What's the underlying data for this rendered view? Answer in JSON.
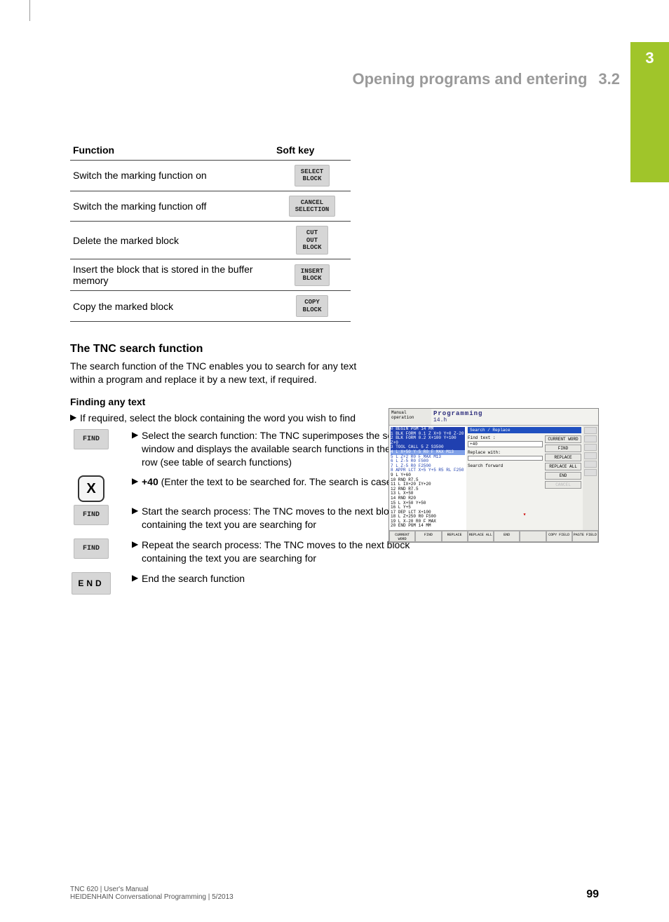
{
  "sideTabChapter": "3",
  "header": {
    "title": "Opening programs and entering",
    "section": "3.2"
  },
  "table": {
    "col1": "Function",
    "col2": "Soft key",
    "rows": [
      {
        "desc": "Switch the marking function on",
        "key": "SELECT\nBLOCK"
      },
      {
        "desc": "Switch the marking function off",
        "key": "CANCEL\nSELECTION"
      },
      {
        "desc": "Delete the marked block",
        "key": "CUT\nOUT\nBLOCK"
      },
      {
        "desc": "Insert the block that is stored in the buffer memory",
        "key": "INSERT\nBLOCK"
      },
      {
        "desc": "Copy the marked block",
        "key": "COPY\nBLOCK"
      }
    ]
  },
  "subheading": "The TNC search function",
  "subpara": "The search function of the TNC enables you to search for any text within a program and replace it by a new text, if required.",
  "minihead": "Finding any text",
  "step0": "If required, select the block containing the word you wish to find",
  "steps": [
    {
      "iconType": "softkey",
      "iconLabel": "FIND",
      "text": "Select the search function: The TNC superimposes the search window and displays the available search functions in the soft-key row (see table of search functions)"
    },
    {
      "iconType": "axis",
      "iconLabel": "X",
      "bold": "+40",
      "text": " (Enter the text to be searched for. The search is case-sensitive.)"
    },
    {
      "iconType": "softkey",
      "iconLabel": "FIND",
      "text": "Start the search process: The TNC moves to the next block containing the text you are searching for"
    },
    {
      "iconType": "softkey",
      "iconLabel": "FIND",
      "text": "Repeat the search process: The TNC moves to the next block containing the text you are searching for"
    },
    {
      "iconType": "end",
      "iconLabel": "END",
      "text": "End the search function"
    }
  ],
  "screenshot": {
    "mode": "Manual operation",
    "title": "Programming",
    "file": "14.h",
    "program": [
      "0  BEGIN PGM 14 MM",
      "1  BLK FORM 0.1 Z X+0 Y+0 Z-20",
      "2  BLK FORM 0.2 X+100 Y+100 Z+0",
      "3  TOOL CALL 5 Z S3500",
      "4  L X+50 Y-5 R0 F MAX M13",
      "5  L Z+2 R0 F MAX M13",
      "6  L Z-5 R0 F500",
      "7  L Z-5 R0 F2500",
      "8  APPR LCT X+5 Y+5 R5 RL F250",
      "9  L Y+60",
      "10 RND R7.5",
      "11 L IX+20 IY+20",
      "12 RND R7.5",
      "13 L X+50",
      "14 RND R20",
      "15 L X+50 Y+50",
      "16 L Y+5",
      "17 DEP LCT X+100",
      "18 L Z+250 R0 F500",
      "19 L X-20 R0 F MAX",
      "20 END PGM 14 MM"
    ],
    "dialogTitle": "Search / Replace",
    "findLabel": "Find text :",
    "findValue": "+40",
    "replaceLabel": "Replace with:",
    "searchForwardLabel": "Search forward",
    "dlgButtons": [
      "CURRENT WORD",
      "FIND",
      "REPLACE",
      "REPLACE ALL",
      "END",
      "CANCEL"
    ],
    "bottomKeys": [
      "CURRENT WORD",
      "FIND",
      "REPLACE",
      "REPLACE ALL",
      "END",
      "",
      "COPY FIELD",
      "PASTE FIELD"
    ]
  },
  "footerLine1": "TNC 620 | User's Manual",
  "footerLine2": "HEIDENHAIN Conversational Programming | 5/2013",
  "pageNum": "99"
}
